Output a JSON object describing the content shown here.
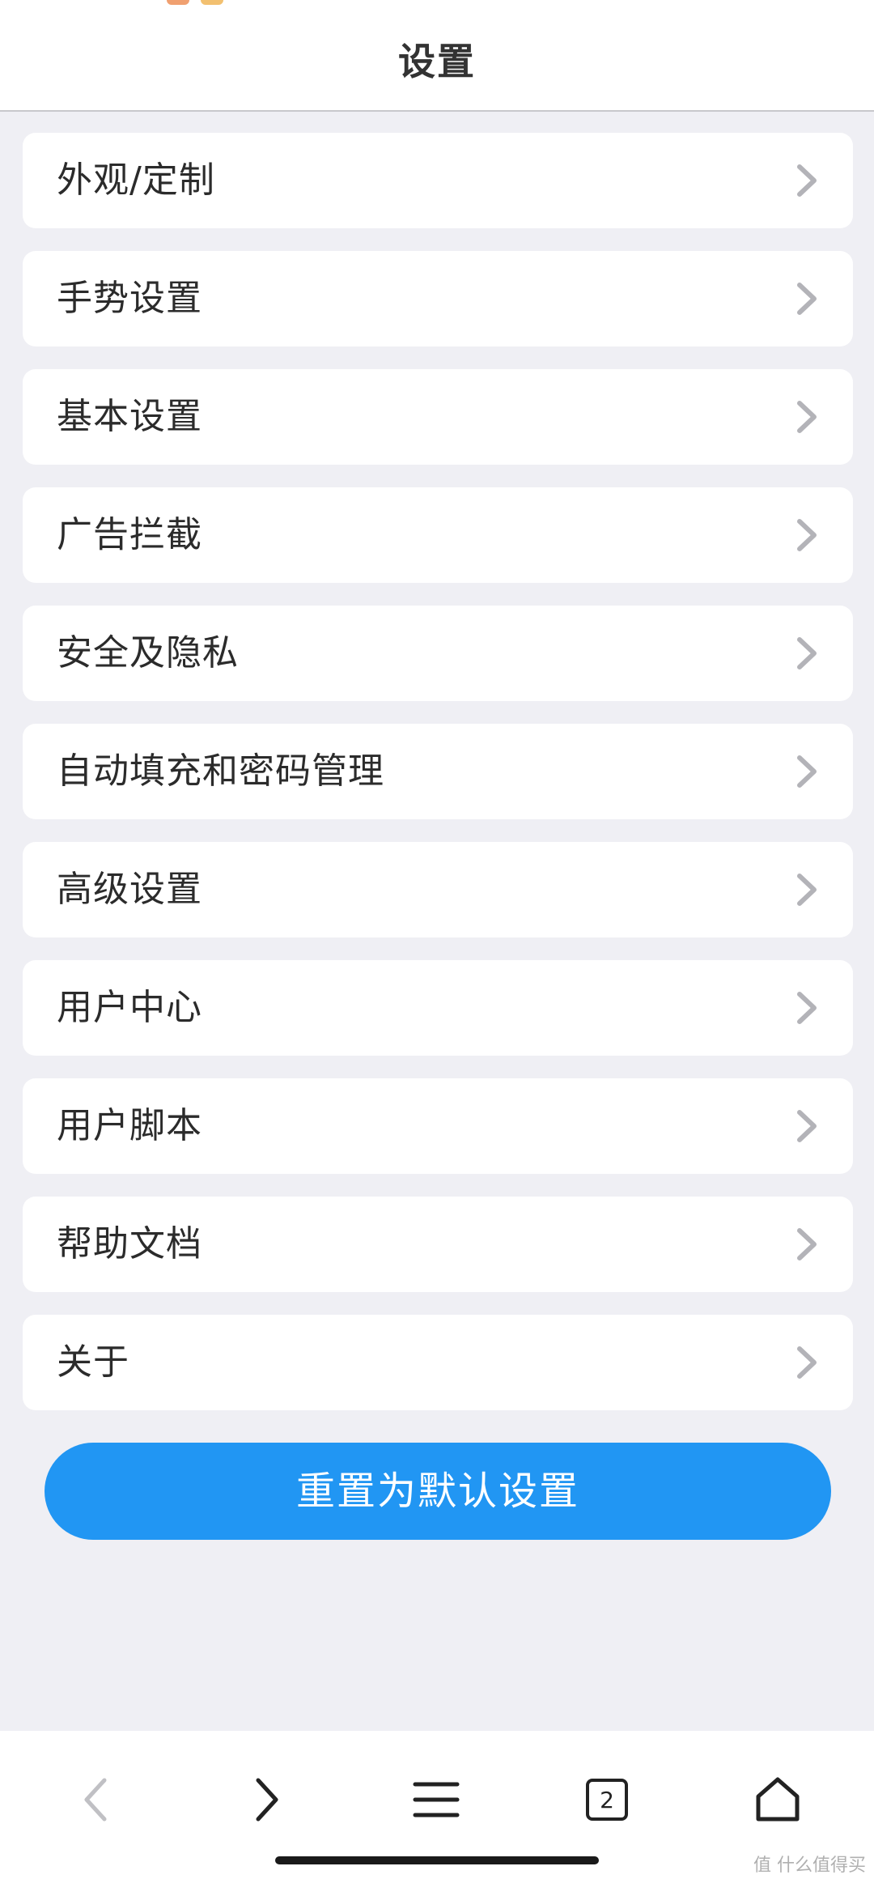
{
  "header": {
    "title": "设置"
  },
  "settings": {
    "items": [
      {
        "label": "外观/定制"
      },
      {
        "label": "手势设置"
      },
      {
        "label": "基本设置"
      },
      {
        "label": "广告拦截"
      },
      {
        "label": "安全及隐私"
      },
      {
        "label": "自动填充和密码管理"
      },
      {
        "label": "高级设置"
      },
      {
        "label": "用户中心"
      },
      {
        "label": "用户脚本"
      },
      {
        "label": "帮助文档"
      },
      {
        "label": "关于"
      }
    ],
    "chevron_icon": "chevron-right-icon"
  },
  "reset_button": {
    "label": "重置为默认设置"
  },
  "bottom_nav": {
    "back_icon": "chevron-left-icon",
    "forward_icon": "chevron-right-icon",
    "menu_icon": "menu-icon",
    "tabs_icon": "tabs-icon",
    "tab_count": "2",
    "home_icon": "home-icon"
  },
  "watermark": {
    "text": "值 什么值得买"
  },
  "colors": {
    "background": "#efeff4",
    "card": "#ffffff",
    "accent": "#2196f3",
    "chevron": "#b3b3b8",
    "nav_disabled": "#c0c0c4",
    "nav_active": "#222222"
  }
}
